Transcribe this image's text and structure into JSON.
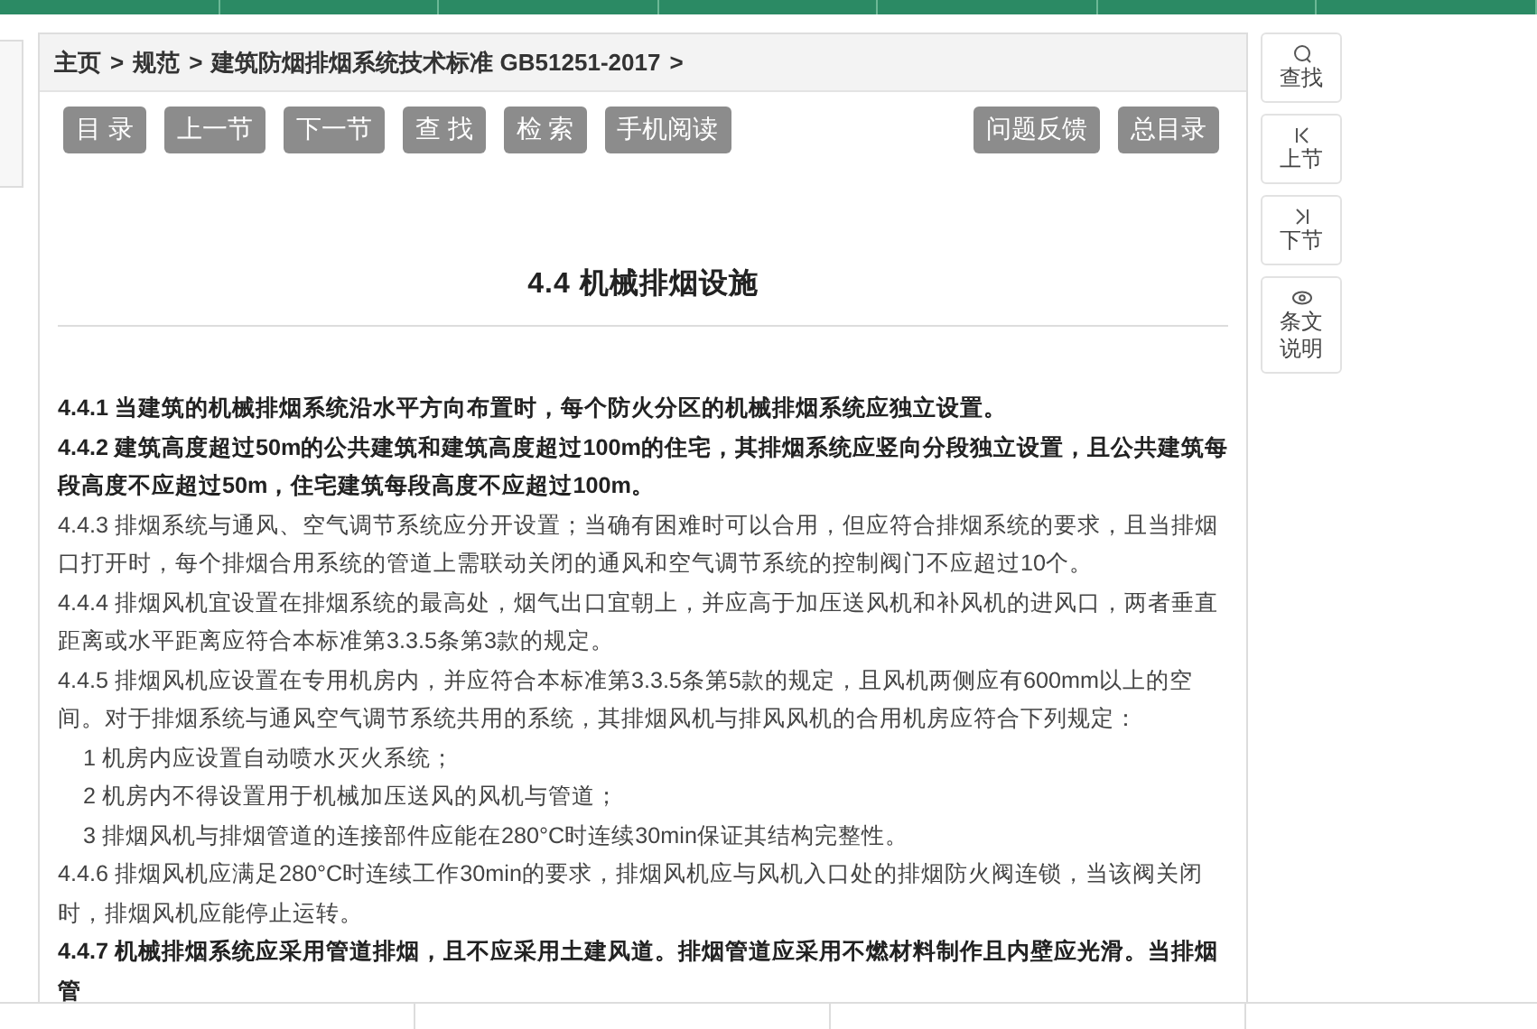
{
  "breadcrumb": [
    "主页",
    "规范",
    "建筑防烟排烟系统技术标准 GB51251-2017"
  ],
  "breadcrumb_separator": ">",
  "toolbar_left": [
    "目 录",
    "上一节",
    "下一节",
    "查 找",
    "检 索",
    "手机阅读"
  ],
  "toolbar_right": [
    "问题反馈",
    "总目录"
  ],
  "section_title": "4.4 机械排烟设施",
  "paragraphs": [
    {
      "kind": "bold",
      "text": "4.4.1 当建筑的机械排烟系统沿水平方向布置时，每个防火分区的机械排烟系统应独立设置。"
    },
    {
      "kind": "bold",
      "text": "4.4.2 建筑高度超过50m的公共建筑和建筑高度超过100m的住宅，其排烟系统应竖向分段独立设置，且公共建筑每段高度不应超过50m，住宅建筑每段高度不应超过100m。"
    },
    {
      "kind": "normal",
      "text": "4.4.3 排烟系统与通风、空气调节系统应分开设置；当确有困难时可以合用，但应符合排烟系统的要求，且当排烟口打开时，每个排烟合用系统的管道上需联动关闭的通风和空气调节系统的控制阀门不应超过10个。"
    },
    {
      "kind": "normal",
      "text": "4.4.4 排烟风机宜设置在排烟系统的最高处，烟气出口宜朝上，并应高于加压送风机和补风机的进风口，两者垂直距离或水平距离应符合本标准第3.3.5条第3款的规定。"
    },
    {
      "kind": "normal",
      "text": "4.4.5 排烟风机应设置在专用机房内，并应符合本标准第3.3.5条第5款的规定，且风机两侧应有600mm以上的空间。对于排烟系统与通风空气调节系统共用的系统，其排烟风机与排风风机的合用机房应符合下列规定："
    },
    {
      "kind": "item",
      "text": "1 机房内应设置自动喷水灭火系统；"
    },
    {
      "kind": "item",
      "text": "2 机房内不得设置用于机械加压送风的风机与管道；"
    },
    {
      "kind": "item",
      "text": "3 排烟风机与排烟管道的连接部件应能在280°C时连续30min保证其结构完整性。"
    },
    {
      "kind": "normal",
      "text": "4.4.6 排烟风机应满足280°C时连续工作30min的要求，排烟风机应与风机入口处的排烟防火阀连锁，当该阀关闭时，排烟风机应能停止运转。"
    },
    {
      "kind": "bold",
      "text": "4.4.7 机械排烟系统应采用管道排烟，且不应采用土建风道。排烟管道应采用不燃材料制作且内壁应光滑。当排烟管"
    }
  ],
  "side_buttons": [
    {
      "kind": "search",
      "label": "查找"
    },
    {
      "kind": "prev",
      "label": "上节"
    },
    {
      "kind": "next",
      "label": "下节"
    },
    {
      "kind": "eye",
      "label": "条文说明"
    }
  ]
}
